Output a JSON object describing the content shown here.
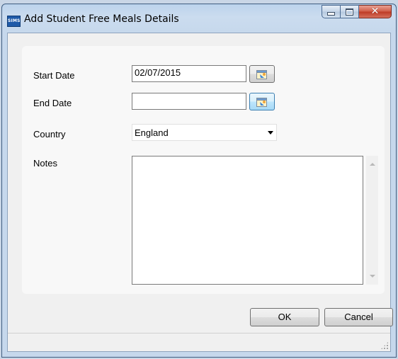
{
  "window": {
    "title": "Add Student Free Meals Details",
    "app_icon_text": "SIMS"
  },
  "controls": {
    "minimize": "minimize-icon",
    "maximize": "maximize-icon",
    "close": "close-icon",
    "close_color": "#c8462f"
  },
  "form": {
    "start_date_label": "Start Date",
    "start_date_value": "02/07/2015",
    "end_date_label": "End Date",
    "end_date_value": "",
    "country_label": "Country",
    "country_value": "England",
    "notes_label": "Notes",
    "notes_value": ""
  },
  "buttons": {
    "ok": "OK",
    "cancel": "Cancel"
  },
  "icons": {
    "calendar": "calendar-icon",
    "dropdown": "chevron-down-icon"
  }
}
